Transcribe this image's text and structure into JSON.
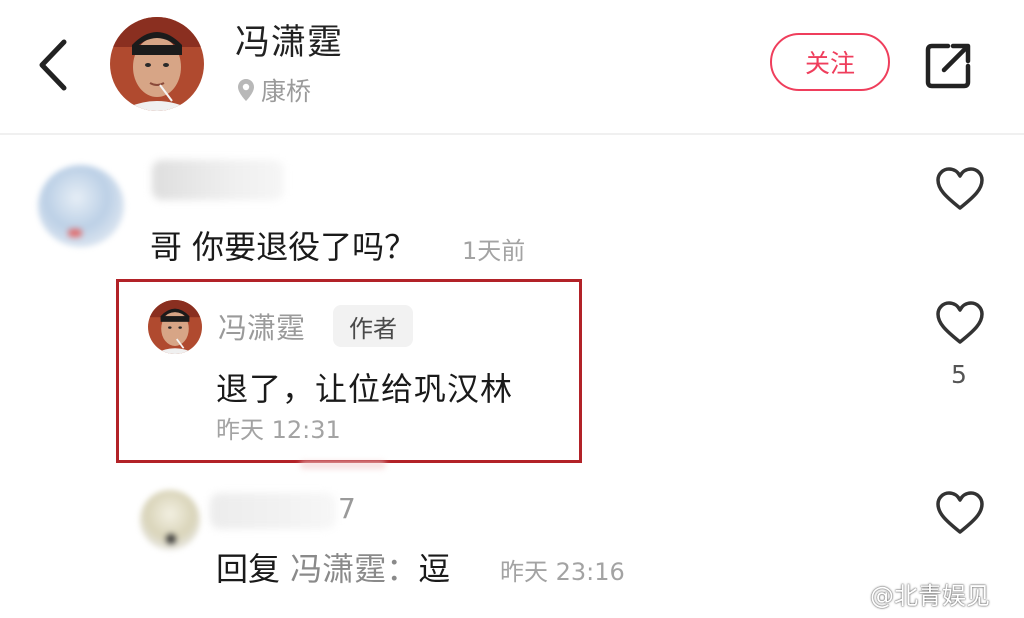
{
  "header": {
    "username": "冯潇霆",
    "location": "康桥",
    "follow_label": "关注"
  },
  "comment": {
    "text": "哥 你要退役了吗？",
    "time": "1天前"
  },
  "author_reply": {
    "name": "冯潇霆",
    "badge": "作者",
    "text": "退了，让位给巩汉林",
    "time": "昨天 12:31",
    "like_count": "5"
  },
  "second_reply": {
    "name_suffix": "7",
    "label": "回复",
    "target": "冯潇霆：",
    "text": "逗",
    "time": "昨天 23:16"
  },
  "watermark": "@北青娱见",
  "colors": {
    "accent": "#ef3e5c",
    "highlight_box": "#b22228",
    "muted_text": "#a3a3a3"
  },
  "icons": [
    "back-chevron-icon",
    "location-pin-icon",
    "share-icon",
    "heart-icon",
    "weibo-logo-icon"
  ]
}
